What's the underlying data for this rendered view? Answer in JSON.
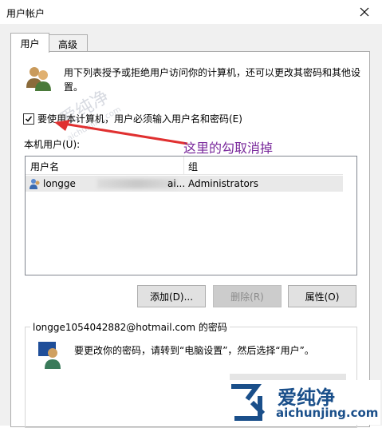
{
  "window": {
    "title": "用户帐户"
  },
  "tabs": [
    {
      "label": "用户"
    },
    {
      "label": "高级"
    }
  ],
  "intro": {
    "text": "用下列表授予或拒绝用户访问你的计算机，还可以更改其密码和其他设置。"
  },
  "checkbox": {
    "label": "要使用本计算机，用户必须输入用户名和密码(E)",
    "checked": true
  },
  "annotation": {
    "text": "这里的勾取消掉",
    "color": "#7a2a9c"
  },
  "users_list": {
    "label": "本机用户(U):",
    "columns": [
      "用户名",
      "组"
    ],
    "rows": [
      {
        "name": "longge",
        "name_tail": "ai...",
        "group": "Administrators"
      }
    ]
  },
  "buttons": {
    "add": "添加(D)...",
    "remove": "删除(R)",
    "properties": "属性(O)"
  },
  "password": {
    "legend": "longge1054042882@hotmail.com 的密码",
    "text": "要更改你的密码，请转到“电脑设置”，然后选择“用户”。"
  },
  "watermark": {
    "text": "爱纯净",
    "url": "aichunjing.com"
  },
  "colors": {
    "watermark": "#1a4f8a",
    "disabled_button": "#cccccc"
  }
}
